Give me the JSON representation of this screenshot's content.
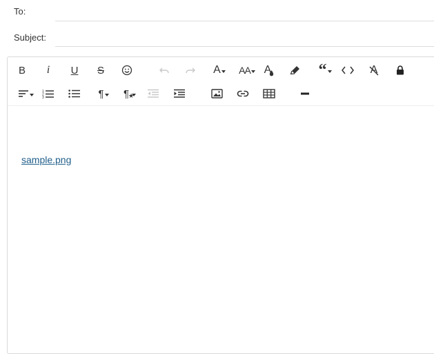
{
  "compose": {
    "to_label": "To:",
    "to_value": "",
    "subject_label": "Subject:",
    "subject_value": ""
  },
  "toolbar": {
    "row1": [
      {
        "name": "bold",
        "icon": "bold-icon",
        "glyph": "B"
      },
      {
        "name": "italic",
        "icon": "italic-icon",
        "glyph": "i"
      },
      {
        "name": "underline",
        "icon": "underline-icon",
        "glyph": "U"
      },
      {
        "name": "strikethrough",
        "icon": "strikethrough-icon",
        "glyph": "S"
      },
      {
        "name": "emoji",
        "icon": "smiley-icon"
      },
      {
        "name": "undo",
        "icon": "undo-icon",
        "disabled": true
      },
      {
        "name": "redo",
        "icon": "redo-icon",
        "disabled": true
      },
      {
        "name": "font-family",
        "icon": "font-family-icon",
        "glyph": "A"
      },
      {
        "name": "font-size",
        "icon": "font-size-icon",
        "glyph": "AA"
      },
      {
        "name": "text-color",
        "icon": "text-color-icon",
        "glyph": "A"
      },
      {
        "name": "highlight",
        "icon": "highlighter-icon"
      },
      {
        "name": "blockquote",
        "icon": "quote-icon",
        "glyph": "“"
      },
      {
        "name": "code",
        "icon": "code-icon",
        "glyph": "<>"
      },
      {
        "name": "clear-format",
        "icon": "clear-format-icon",
        "glyph": "A"
      },
      {
        "name": "lock",
        "icon": "lock-icon"
      }
    ],
    "row2": [
      {
        "name": "align",
        "icon": "align-left-icon"
      },
      {
        "name": "ordered-list",
        "icon": "ordered-list-icon"
      },
      {
        "name": "unordered-list",
        "icon": "unordered-list-icon"
      },
      {
        "name": "paragraph-format",
        "icon": "paragraph-icon",
        "glyph": "¶"
      },
      {
        "name": "paragraph-style",
        "icon": "paragraph-style-icon",
        "glyph": "¶"
      },
      {
        "name": "outdent",
        "icon": "outdent-icon",
        "disabled": true
      },
      {
        "name": "indent",
        "icon": "indent-icon"
      },
      {
        "name": "insert-image",
        "icon": "image-icon"
      },
      {
        "name": "insert-link",
        "icon": "link-icon"
      },
      {
        "name": "insert-table",
        "icon": "table-icon"
      },
      {
        "name": "horizontal-rule",
        "icon": "horizontal-rule-icon"
      }
    ]
  },
  "body": {
    "attachment_link": "sample.png"
  }
}
